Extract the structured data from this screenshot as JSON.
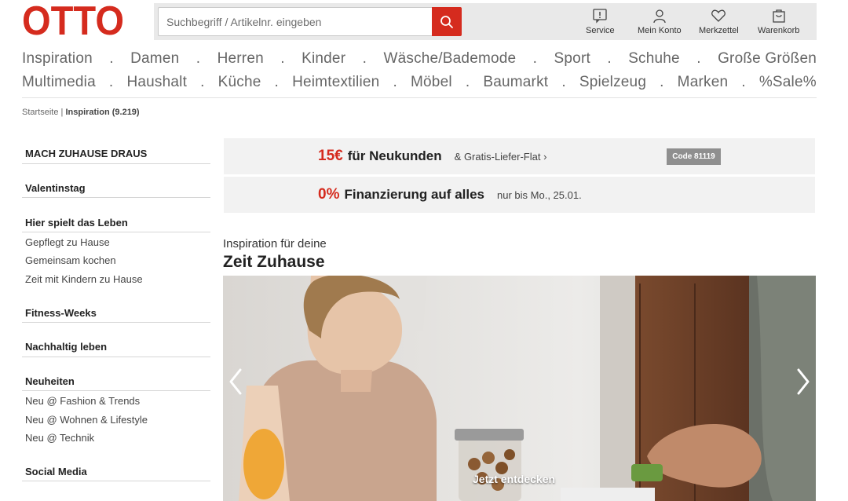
{
  "header": {
    "logo_text": "OTTO",
    "search": {
      "placeholder": "Suchbegriff / Artikelnr. eingeben"
    },
    "actions": [
      {
        "label": "Service",
        "icon": "info-icon"
      },
      {
        "label": "Mein Konto",
        "icon": "user-icon"
      },
      {
        "label": "Merkzettel",
        "icon": "heart-icon"
      },
      {
        "label": "Warenkorb",
        "icon": "cart-icon"
      }
    ]
  },
  "nav": {
    "row1": [
      "Inspiration",
      "Damen",
      "Herren",
      "Kinder",
      "Wäsche/Bademode",
      "Sport",
      "Schuhe",
      "Große Größen"
    ],
    "row2": [
      "Multimedia",
      "Haushalt",
      "Küche",
      "Heimtextilien",
      "Möbel",
      "Baumarkt",
      "Spielzeug",
      "Marken",
      "%Sale%"
    ],
    "separator": "."
  },
  "breadcrumb": {
    "home": "Startseite",
    "separator": "|",
    "current": "Inspiration (9.219)"
  },
  "sidebar": {
    "sections": [
      {
        "title": "MACH ZUHAUSE DRAUS",
        "links": []
      },
      {
        "title": "Valentinstag",
        "links": []
      },
      {
        "title": "Hier spielt das Leben",
        "links": [
          "Gepflegt zu Hause",
          "Gemeinsam kochen",
          "Zeit mit Kindern zu Hause"
        ]
      },
      {
        "title": "Fitness-Weeks",
        "links": []
      },
      {
        "title": "Nachhaltig leben",
        "links": []
      },
      {
        "title": "Neuheiten",
        "links": [
          "Neu @ Fashion & Trends",
          "Neu @ Wohnen & Lifestyle",
          "Neu @ Technik"
        ]
      },
      {
        "title": "Social Media",
        "links": []
      }
    ]
  },
  "promos": [
    {
      "highlight": "15€",
      "main": "für Neukunden",
      "sub": "& Gratis-Liefer-Flat ›",
      "code": "Code 81119"
    },
    {
      "highlight": "0%",
      "main": "Finanzierung auf alles",
      "sub": "nur bis Mo., 25.01."
    }
  ],
  "inspiration": {
    "subtitle": "Inspiration für deine",
    "title": "Zeit Zuhause",
    "cta": "Jetzt entdecken"
  },
  "colors": {
    "brand_red": "#d52b1e",
    "header_bg": "#e9e9e9",
    "promo_bg": "#f2f2f2"
  }
}
